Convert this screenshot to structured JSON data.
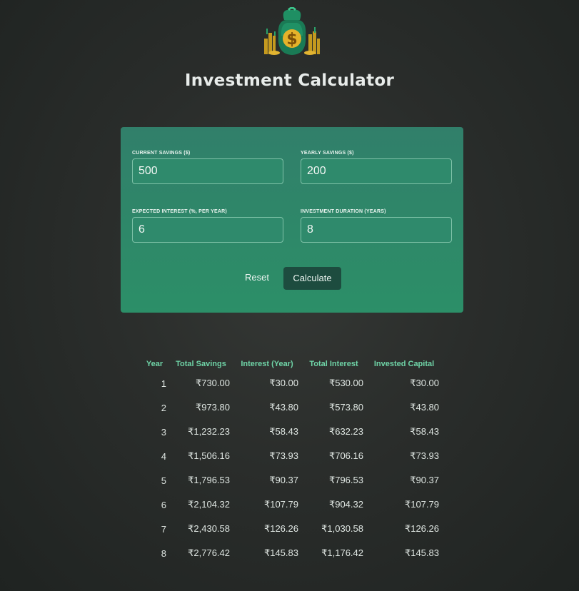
{
  "header": {
    "logo_icon": "money-bag-icon",
    "title": "Investment Calculator"
  },
  "form": {
    "current_savings": {
      "label": "Current Savings ($)",
      "value": "500"
    },
    "yearly_savings": {
      "label": "Yearly Savings ($)",
      "value": "200"
    },
    "expected_interest": {
      "label": "Expected Interest (%, per year)",
      "value": "6"
    },
    "duration": {
      "label": "Investment Duration (years)",
      "value": "8"
    },
    "reset_label": "Reset",
    "calculate_label": "Calculate"
  },
  "colors": {
    "card": "#2e8a6a",
    "button": "#1d4c3f",
    "header_text": "#6fd4a7",
    "background": "#2c2f2d"
  },
  "table": {
    "columns": [
      "Year",
      "Total Savings",
      "Interest (Year)",
      "Total Interest",
      "Invested Capital"
    ],
    "rows": [
      [
        "1",
        "₹730.00",
        "₹30.00",
        "₹530.00",
        "₹30.00"
      ],
      [
        "2",
        "₹973.80",
        "₹43.80",
        "₹573.80",
        "₹43.80"
      ],
      [
        "3",
        "₹1,232.23",
        "₹58.43",
        "₹632.23",
        "₹58.43"
      ],
      [
        "4",
        "₹1,506.16",
        "₹73.93",
        "₹706.16",
        "₹73.93"
      ],
      [
        "5",
        "₹1,796.53",
        "₹90.37",
        "₹796.53",
        "₹90.37"
      ],
      [
        "6",
        "₹2,104.32",
        "₹107.79",
        "₹904.32",
        "₹107.79"
      ],
      [
        "7",
        "₹2,430.58",
        "₹126.26",
        "₹1,030.58",
        "₹126.26"
      ],
      [
        "8",
        "₹2,776.42",
        "₹145.83",
        "₹1,176.42",
        "₹145.83"
      ]
    ]
  }
}
